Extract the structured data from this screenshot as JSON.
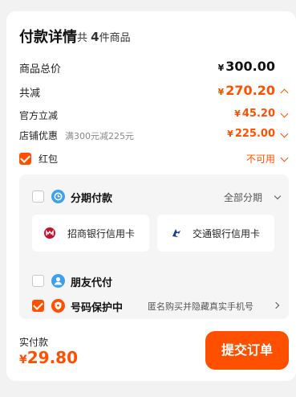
{
  "header": {
    "title": "付款详情",
    "count_prefix": "共",
    "count_value": "4",
    "count_suffix": "件商品"
  },
  "rows": {
    "goods_total": {
      "label": "商品总价",
      "currency": "¥",
      "amount": "300.00"
    },
    "total_discount": {
      "label": "共减",
      "currency": "¥",
      "amount": "270.20"
    },
    "official_discount": {
      "label": "官方立减",
      "currency": "¥",
      "amount": "45.20"
    },
    "store_discount": {
      "label": "店铺优惠",
      "note": "满300元减225元",
      "currency": "¥",
      "amount": "225.00"
    },
    "red_packet": {
      "label": "红包",
      "status": "不可用",
      "checked": true
    }
  },
  "payment_options": {
    "installment": {
      "label": "分期付款",
      "action": "全部分期",
      "checked": false,
      "icon": "installment-icon"
    },
    "banks": [
      {
        "name": "招商银行信用卡",
        "icon": "cmb-logo-icon",
        "color": "#c8102e"
      },
      {
        "name": "交通银行信用卡",
        "icon": "bocom-logo-icon",
        "color": "#1a3a8c"
      }
    ],
    "friend_pay": {
      "label": "朋友代付",
      "checked": false,
      "icon": "friend-pay-icon"
    },
    "number_protect": {
      "label": "号码保护中",
      "hint": "匿名购买并隐藏真实手机号",
      "checked": true,
      "icon": "shield-icon"
    }
  },
  "footer": {
    "paid_label": "实付款",
    "currency": "¥",
    "paid_amount": "29.80",
    "submit_label": "提交订单"
  },
  "colors": {
    "accent": "#ff5000",
    "background": "#f2f2f2",
    "panel": "#f5f5f5"
  }
}
